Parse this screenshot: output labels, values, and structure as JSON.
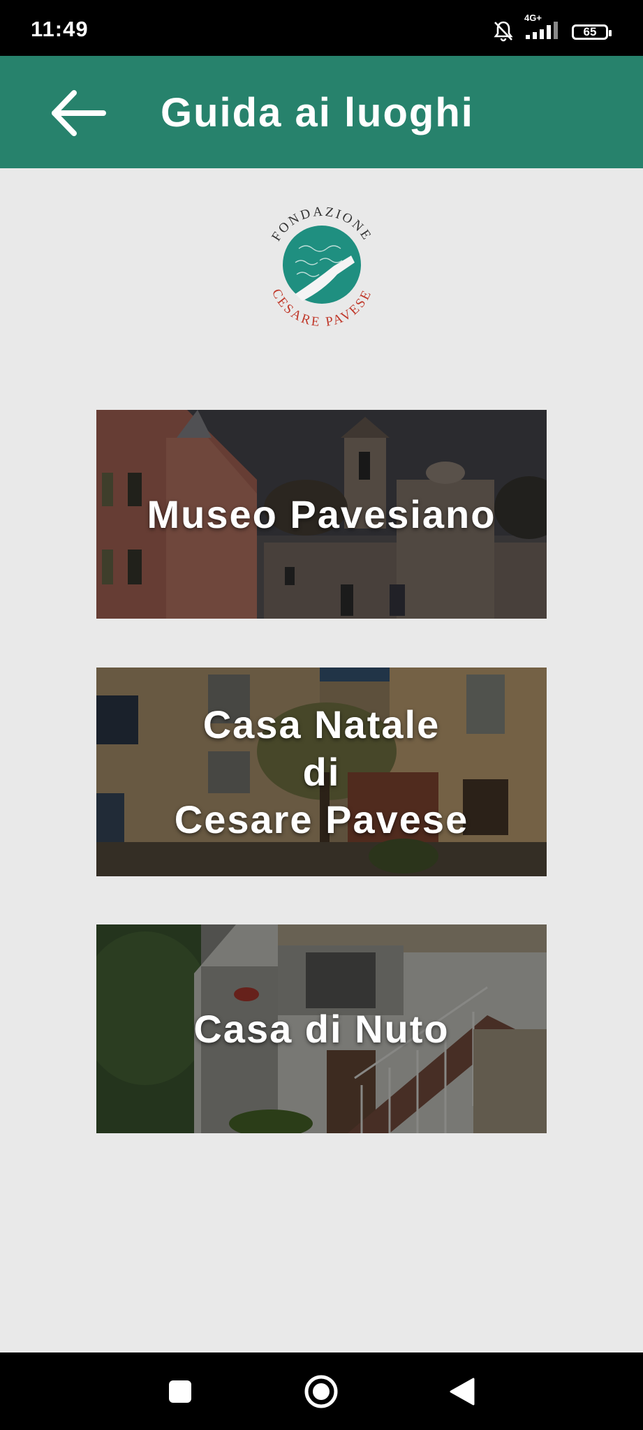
{
  "status_bar": {
    "time": "11:49",
    "network": "4G+",
    "battery": "65",
    "icons": [
      "bell-off-icon",
      "signal-icon",
      "battery-icon"
    ]
  },
  "app_bar": {
    "title": "Guida ai luoghi",
    "back_icon": "arrow-left-icon",
    "color": "#27826c"
  },
  "logo": {
    "top_text": "FONDAZIONE",
    "bottom_text": "CESARE PAVESE"
  },
  "places": [
    {
      "label": "Museo Pavesiano"
    },
    {
      "label": "Casa Natale\ndi\nCesare Pavese"
    },
    {
      "label": "Casa di Nuto"
    }
  ],
  "nav_bar": {
    "icons": [
      "recents-square-icon",
      "home-circle-icon",
      "back-triangle-icon"
    ]
  }
}
